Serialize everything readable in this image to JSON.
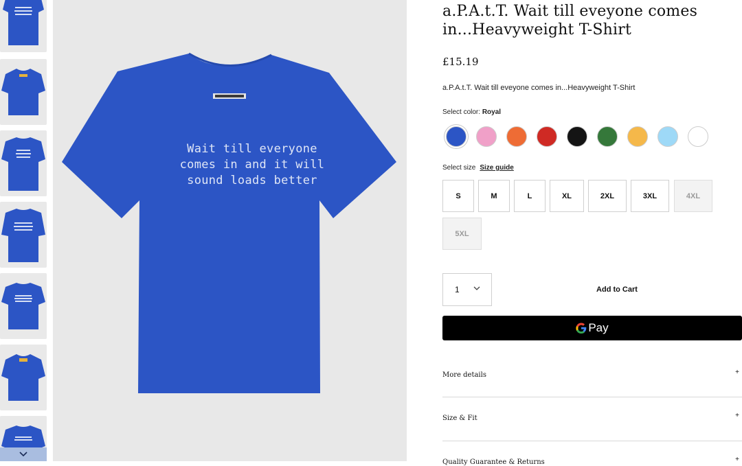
{
  "thumbnails": [
    {
      "alt": "thumbnail-1"
    },
    {
      "alt": "thumbnail-2"
    },
    {
      "alt": "thumbnail-3"
    },
    {
      "alt": "thumbnail-4"
    },
    {
      "alt": "thumbnail-5"
    },
    {
      "alt": "thumbnail-6"
    },
    {
      "alt": "thumbnail-7"
    }
  ],
  "thumbnail_scroll_icon": "chevron-down-icon",
  "main_image": {
    "shirt_color": "#2c55c5",
    "shirt_text": [
      "Wait till everyone",
      "comes in and it will",
      "sound loads better"
    ]
  },
  "product": {
    "title_lines": [
      "a.P.A.t.T. Wait till eveyone comes",
      "in...Heavyweight T-Shirt"
    ],
    "price": "£15.19",
    "subtitle": "a.P.A.t.T.  Wait till eveyone comes in...Heavyweight T-Shirt"
  },
  "color": {
    "label": "Select color: ",
    "selected": "Royal",
    "swatches": [
      {
        "name": "Royal",
        "hex": "#2c55c5",
        "selected": true
      },
      {
        "name": "Pink",
        "hex": "#f0a0c8",
        "selected": false
      },
      {
        "name": "Orange",
        "hex": "#ee6c35",
        "selected": false
      },
      {
        "name": "Red",
        "hex": "#cf2a24",
        "selected": false
      },
      {
        "name": "Black",
        "hex": "#141414",
        "selected": false
      },
      {
        "name": "Green",
        "hex": "#35783a",
        "selected": false
      },
      {
        "name": "Gold",
        "hex": "#f5b84a",
        "selected": false
      },
      {
        "name": "Light Blue",
        "hex": "#9ed9f7",
        "selected": false
      },
      {
        "name": "White",
        "hex": "#ffffff",
        "selected": false
      }
    ]
  },
  "size": {
    "label": "Select size",
    "guide_label": "Size guide",
    "options": [
      {
        "label": "S",
        "available": true
      },
      {
        "label": "M",
        "available": true
      },
      {
        "label": "L",
        "available": true
      },
      {
        "label": "XL",
        "available": true
      },
      {
        "label": "2XL",
        "available": true
      },
      {
        "label": "3XL",
        "available": true
      },
      {
        "label": "4XL",
        "available": false
      },
      {
        "label": "5XL",
        "available": false
      }
    ]
  },
  "cart": {
    "quantity": "1",
    "add_label": "Add to Cart",
    "gpay_label": "Pay"
  },
  "accordions": [
    {
      "label": "More details",
      "icon": "+"
    },
    {
      "label": "Size & Fit",
      "icon": "+"
    },
    {
      "label": "Quality Guarantee & Returns",
      "icon": "+"
    }
  ]
}
